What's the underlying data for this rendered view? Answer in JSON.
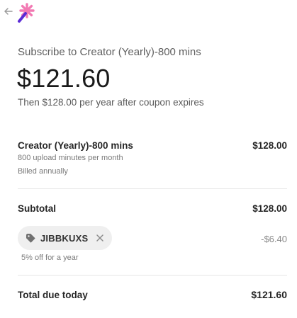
{
  "header": {
    "back_icon": "arrow-left-icon",
    "logo_icon": "sparkle-wand-logo"
  },
  "summary": {
    "title": "Subscribe to Creator (Yearly)-800 mins",
    "price": "$121.60",
    "renewal_text": "Then $128.00 per year after coupon expires"
  },
  "line_item": {
    "name": "Creator (Yearly)-800 mins",
    "description": "800 upload minutes per month",
    "billing": "Billed annually",
    "price": "$128.00"
  },
  "subtotal": {
    "label": "Subtotal",
    "value": "$128.00"
  },
  "coupon": {
    "code": "JIBBKUXS",
    "note": "5% off for a year",
    "discount": "-$6.40",
    "tag_icon": "tag-icon",
    "remove_icon": "close-icon"
  },
  "total": {
    "label": "Total due today",
    "value": "$121.60"
  },
  "colors": {
    "logo_pink": "#f27ab3",
    "logo_purple": "#5b2bd6",
    "text_primary": "#1a1a1a",
    "text_secondary": "#7a7a7a",
    "chip_bg": "#efefef"
  }
}
